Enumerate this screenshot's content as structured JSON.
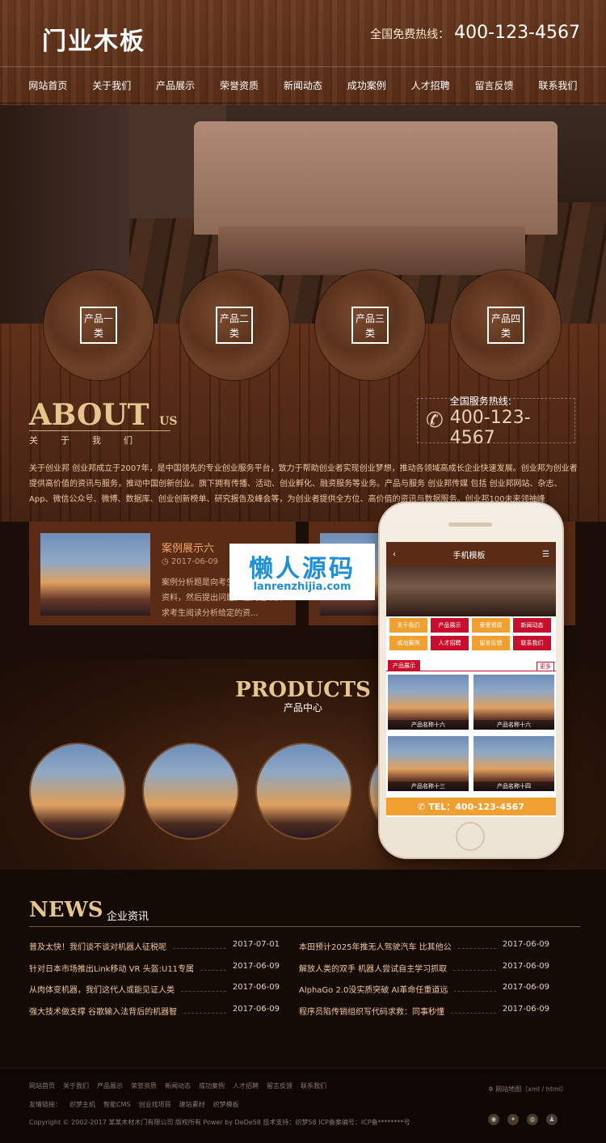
{
  "header": {
    "logo": "门业木板",
    "hotline_label": "全国免费热线：",
    "hotline_number": "400-123-4567"
  },
  "nav": [
    "网站首页",
    "关于我们",
    "产品展示",
    "荣誉资质",
    "新闻动态",
    "成功案例",
    "人才招聘",
    "留言反馈",
    "联系我们"
  ],
  "categories": [
    "产品一类",
    "产品二类",
    "产品三类",
    "产品四类"
  ],
  "about": {
    "title": "ABOUT",
    "title_small": "US",
    "subtitle": "关于我们",
    "service_label": "全国服务热线:",
    "service_number": "400-123-4567",
    "text": "关于创业邦 创业邦成立于2007年，是中国领先的专业创业服务平台，致力于帮助创业者实现创业梦想，推动各领域高成长企业快速发展。创业邦为创业者提供高价值的资讯与服务，推动中国创新创业。旗下拥有传播、活动、创业孵化、融资服务等业务。产品与服务 创业邦传媒 包括 创业邦网站、杂志、App、微信公众号、微博、数据库、创业创新榜单、研究报告及峰会等，为创业者提供全方位、高价值的资讯与数据服务。创业邦100未来领袖峰"
  },
  "cases": [
    {
      "title": "案例展示六",
      "date": "2017-06-09",
      "desc": "案例分析题是向考生提供一段背景资料，然后提出问题，在问题中要求考生阅读分析给定的资..."
    },
    {
      "title": "",
      "date": "",
      "desc": ""
    }
  ],
  "products": {
    "title": "PRODUCTS",
    "subtitle": "产品中心"
  },
  "news": {
    "title": "NEWS",
    "subtitle": "企业资讯",
    "left": [
      {
        "title": "普及太快！我们谈不谈对机器人征税呢",
        "date": "2017-07-01"
      },
      {
        "title": "针对日本市场推出Link移动 VR 头盔:U11专属",
        "date": "2017-06-09"
      },
      {
        "title": "从肉体变机器，我们这代人或能见证人类",
        "date": "2017-06-09"
      },
      {
        "title": "强大技术做支撑 谷歌输入法背后的机器智",
        "date": "2017-06-09"
      }
    ],
    "right": [
      {
        "title": "本田预计2025年推无人驾驶汽车 比其他公",
        "date": "2017-06-09"
      },
      {
        "title": "解放人类的双手 机器人尝试自主学习抓取",
        "date": "2017-06-09"
      },
      {
        "title": "AlphaGo 2.0没实质突破 AI革命任重道远",
        "date": "2017-06-09"
      },
      {
        "title": "程序员陷传销组织写代码求救：同事秒懂",
        "date": "2017-06-09"
      }
    ]
  },
  "footer": {
    "links": [
      "网站首页",
      "关于我们",
      "产品展示",
      "荣誉资质",
      "新闻动态",
      "成功案例",
      "人才招聘",
      "留言反馈",
      "联系我们"
    ],
    "friends": [
      "友情链接：",
      "织梦主机",
      "智能CMS",
      "创业找项目",
      "建站素材",
      "织梦模板"
    ],
    "copyright": "Copyright © 2002-2017 某某木材木门有限公司 版权所有 Power by DeDe58    技术支持：织梦58    ICP备案编号：ICP备********号",
    "sitemap": "网站地图（xml / html）"
  },
  "phone": {
    "title": "手机模板",
    "nav": [
      "关于我们",
      "产品展示",
      "荣誉资质",
      "新闻动态",
      "成功案例",
      "人才招聘",
      "留言反馈",
      "联系我们"
    ],
    "prod_label": "产品展示",
    "more": "更多",
    "prods": [
      "产品名称十六",
      "产品名称十六",
      "产品名称十三",
      "产品名称十四"
    ],
    "tel": "TEL：400-123-4567"
  },
  "watermark": {
    "cn": "懒人源码",
    "url": "lanrenzhijia.com"
  }
}
